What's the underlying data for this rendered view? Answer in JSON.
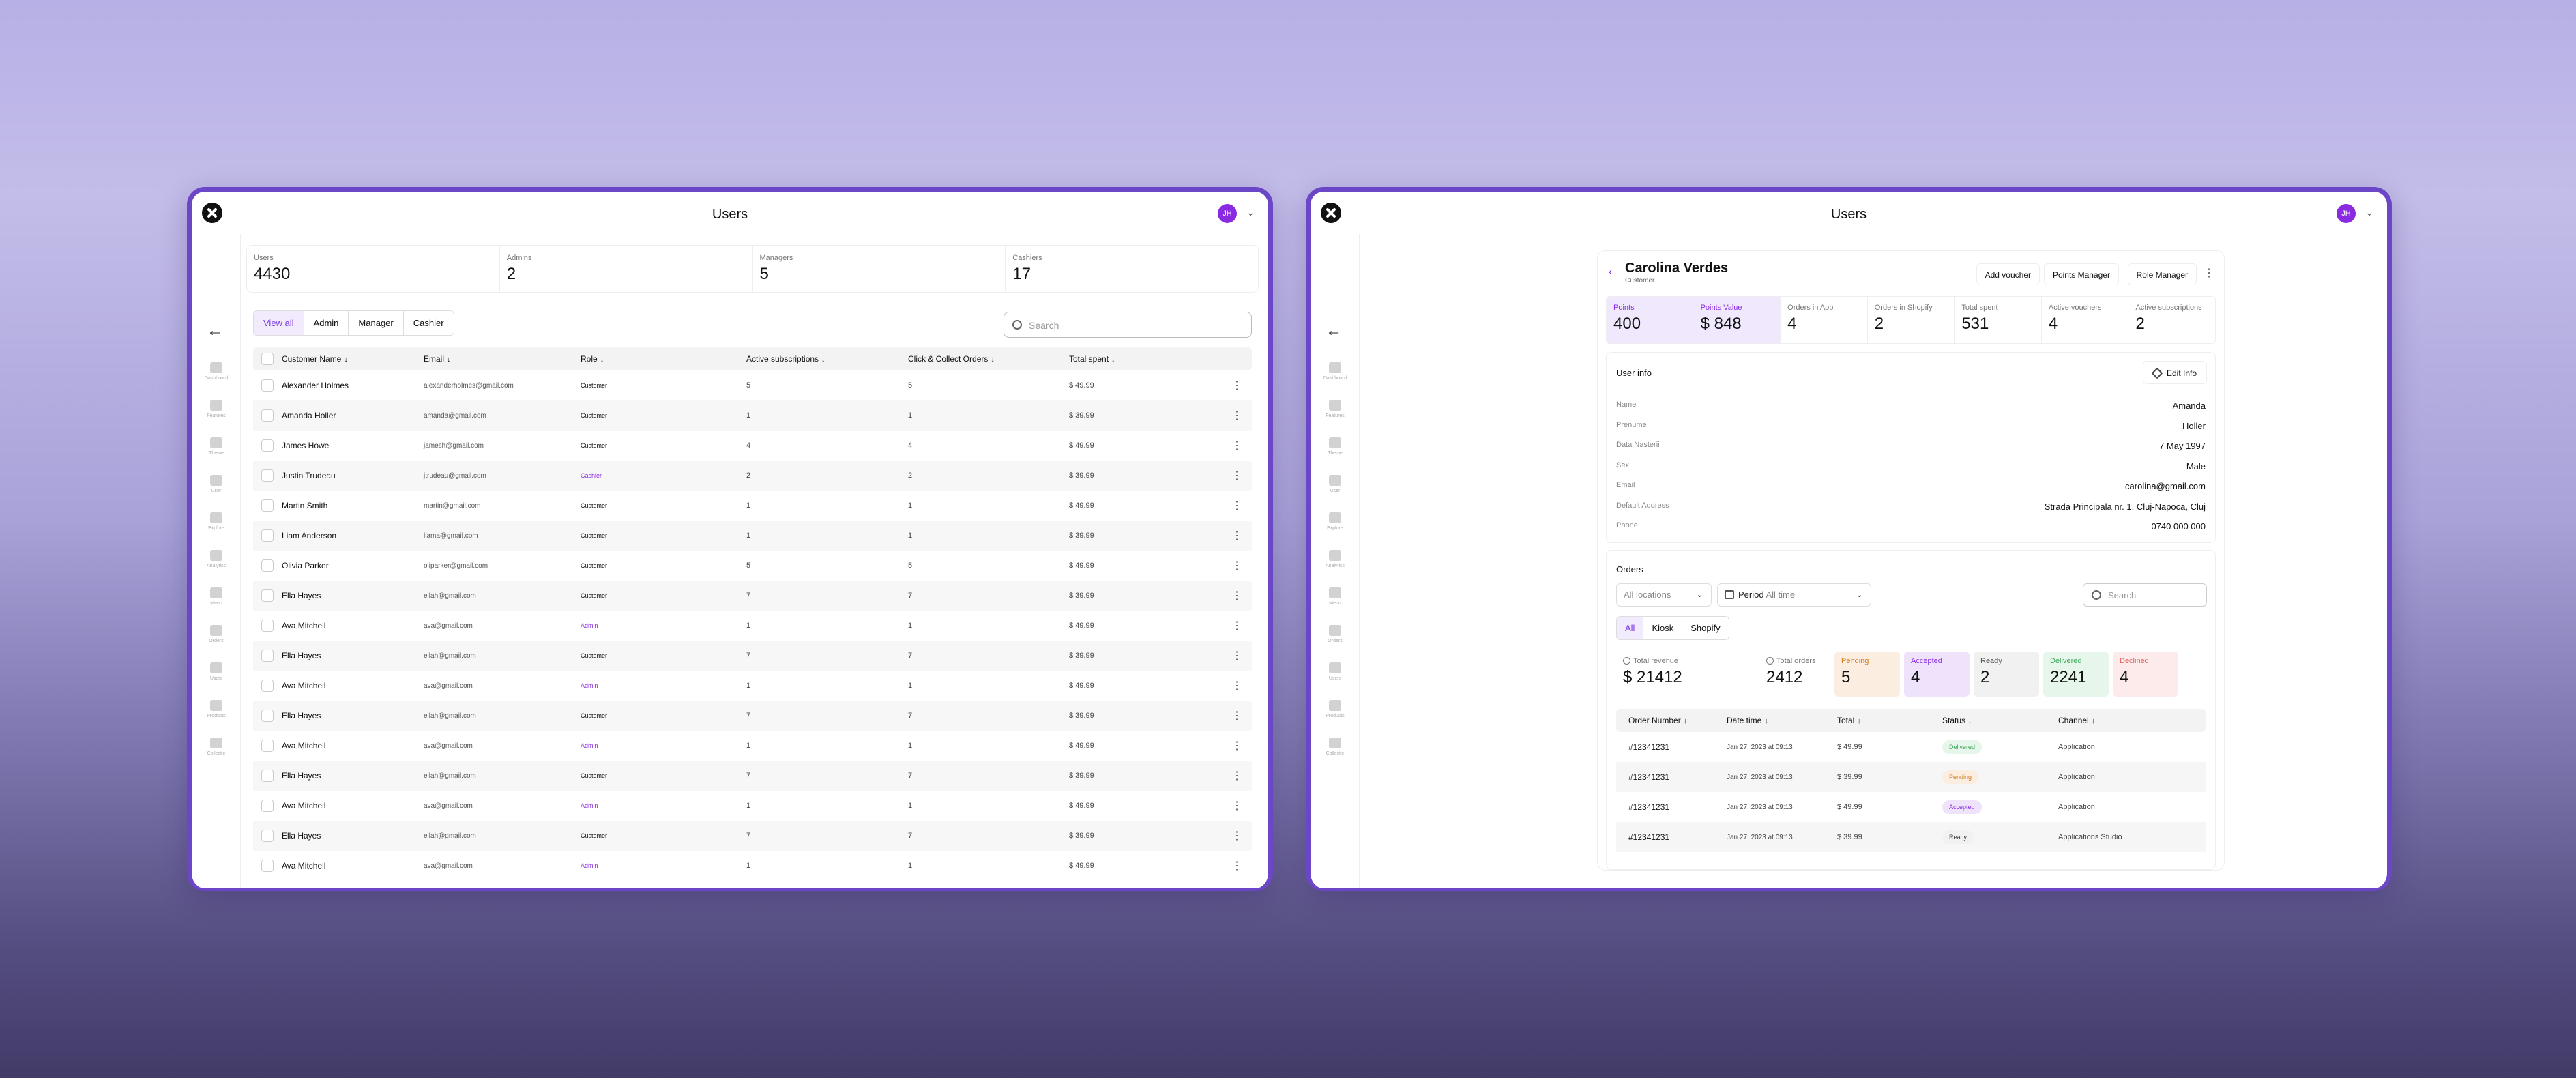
{
  "users_window": {
    "title": "Users",
    "avatar_initials": "JH",
    "sidebar": [
      "Dashboard",
      "Features",
      "Theme",
      "User",
      "Explore",
      "Analytics",
      "Menu",
      "Orders",
      "Users",
      "Products",
      "Collectie"
    ],
    "stats": [
      {
        "label": "Users",
        "value": "4430"
      },
      {
        "label": "Admins",
        "value": "2"
      },
      {
        "label": "Managers",
        "value": "5"
      },
      {
        "label": "Cashiers",
        "value": "17"
      }
    ],
    "tabs": [
      "View all",
      "Admin",
      "Manager",
      "Cashier"
    ],
    "search_placeholder": "Search",
    "columns": [
      "Customer Name",
      "Email",
      "Role",
      "Active subscriptions",
      "Click & Collect Orders",
      "Total spent"
    ],
    "rows": [
      {
        "name": "Alexander Holmes",
        "email": "alexanderholmes@gmail.com",
        "role": "Customer",
        "subs": "5",
        "orders": "5",
        "total": "$ 49.99"
      },
      {
        "name": "Amanda Holler",
        "email": "amanda@gmail.com",
        "role": "Customer",
        "subs": "1",
        "orders": "1",
        "total": "$ 39.99"
      },
      {
        "name": "James Howe",
        "email": "jamesh@gmail.com",
        "role": "Customer",
        "subs": "4",
        "orders": "4",
        "total": "$ 49.99"
      },
      {
        "name": "Justin Trudeau",
        "email": "jtrudeau@gmail.com",
        "role": "Cashier",
        "subs": "2",
        "orders": "2",
        "total": "$ 39.99"
      },
      {
        "name": "Martin Smith",
        "email": "martin@gmail.com",
        "role": "Customer",
        "subs": "1",
        "orders": "1",
        "total": "$ 49.99"
      },
      {
        "name": "Liam Anderson",
        "email": "liama@gmail.com",
        "role": "Customer",
        "subs": "1",
        "orders": "1",
        "total": "$ 39.99"
      },
      {
        "name": "Olivia Parker",
        "email": "oliparker@gmail.com",
        "role": "Customer",
        "subs": "5",
        "orders": "5",
        "total": "$ 49.99"
      },
      {
        "name": "Ella Hayes",
        "email": "ellah@gmail.com",
        "role": "Customer",
        "subs": "7",
        "orders": "7",
        "total": "$ 39.99"
      },
      {
        "name": "Ava Mitchell",
        "email": "ava@gmail.com",
        "role": "Admin",
        "subs": "1",
        "orders": "1",
        "total": "$ 49.99"
      },
      {
        "name": "Ella Hayes",
        "email": "ellah@gmail.com",
        "role": "Customer",
        "subs": "7",
        "orders": "7",
        "total": "$ 39.99"
      },
      {
        "name": "Ava Mitchell",
        "email": "ava@gmail.com",
        "role": "Admin",
        "subs": "1",
        "orders": "1",
        "total": "$ 49.99"
      },
      {
        "name": "Ella Hayes",
        "email": "ellah@gmail.com",
        "role": "Customer",
        "subs": "7",
        "orders": "7",
        "total": "$ 39.99"
      },
      {
        "name": "Ava Mitchell",
        "email": "ava@gmail.com",
        "role": "Admin",
        "subs": "1",
        "orders": "1",
        "total": "$ 49.99"
      },
      {
        "name": "Ella Hayes",
        "email": "ellah@gmail.com",
        "role": "Customer",
        "subs": "7",
        "orders": "7",
        "total": "$ 39.99"
      },
      {
        "name": "Ava Mitchell",
        "email": "ava@gmail.com",
        "role": "Admin",
        "subs": "1",
        "orders": "1",
        "total": "$ 49.99"
      },
      {
        "name": "Ella Hayes",
        "email": "ellah@gmail.com",
        "role": "Customer",
        "subs": "7",
        "orders": "7",
        "total": "$ 39.99"
      },
      {
        "name": "Ava Mitchell",
        "email": "ava@gmail.com",
        "role": "Admin",
        "subs": "1",
        "orders": "1",
        "total": "$ 49.99"
      }
    ]
  },
  "customer_window": {
    "title": "Users",
    "avatar_initials": "JH",
    "sidebar": [
      "Dashboard",
      "Features",
      "Theme",
      "User",
      "Explore",
      "Analytics",
      "Menu",
      "Orders",
      "Users",
      "Products",
      "Collectie"
    ],
    "customer_name": "Carolina Verdes",
    "customer_role": "Customer",
    "actions": [
      "Add voucher",
      "Points Manager",
      "Role Manager"
    ],
    "metrics": [
      {
        "label": "Points",
        "value": "400"
      },
      {
        "label": "Points Value",
        "value": "$ 848"
      },
      {
        "label": "Orders in App",
        "value": "4"
      },
      {
        "label": "Orders in Shopify",
        "value": "2"
      },
      {
        "label": "Total spent",
        "value": "531"
      },
      {
        "label": "Active vouchers",
        "value": "4"
      },
      {
        "label": "Active subscriptions",
        "value": "2"
      }
    ],
    "user_info_title": "User info",
    "edit_label": "Edit Info",
    "info": [
      {
        "key": "Name",
        "value": "Amanda"
      },
      {
        "key": "Prenume",
        "value": "Holler"
      },
      {
        "key": "Data Nasterii",
        "value": "7 May 1997"
      },
      {
        "key": "Sex",
        "value": "Male"
      },
      {
        "key": "Email",
        "value": "carolina@gmail.com"
      },
      {
        "key": "Default Address",
        "value": "Strada Principala nr. 1, Cluj-Napoca, Cluj"
      },
      {
        "key": "Phone",
        "value": "0740 000 000"
      }
    ],
    "orders_title": "Orders",
    "location_filter": "All locations",
    "period_label": "Period",
    "period_value": "All time",
    "search_placeholder": "Search",
    "order_tabs": [
      "All",
      "Kiosk",
      "Shopify"
    ],
    "order_stats": [
      {
        "label": "Total revenue",
        "value": "$ 21412",
        "bg": "#ffffff",
        "color": "#777777"
      },
      {
        "label": "Total orders",
        "value": "2412",
        "bg": "#ffffff",
        "color": "#777777"
      },
      {
        "label": "Pending",
        "value": "5",
        "bg": "#fbeee0",
        "color": "#d07a1e"
      },
      {
        "label": "Accepted",
        "value": "4",
        "bg": "#efe3fb",
        "color": "#8a2be2"
      },
      {
        "label": "Ready",
        "value": "2",
        "bg": "#f1f1f1",
        "color": "#555555"
      },
      {
        "label": "Delivered",
        "value": "2241",
        "bg": "#e6f6ea",
        "color": "#3aa85a"
      },
      {
        "label": "Declined",
        "value": "4",
        "bg": "#fdeaea",
        "color": "#e06060"
      }
    ],
    "order_columns": [
      "Order Number",
      "Date time",
      "Total",
      "Status",
      "Channel"
    ],
    "order_rows": [
      {
        "number": "#12341231",
        "date": "Jan 27, 2023 at 09:13",
        "total": "$ 49.99",
        "status": "Delivered",
        "status_bg": "#e6f6ea",
        "status_color": "#3aa85a",
        "channel": "Application"
      },
      {
        "number": "#12341231",
        "date": "Jan 27, 2023 at 09:13",
        "total": "$  39.99",
        "status": "Pending",
        "status_bg": "#fbeee0",
        "status_color": "#d07a1e",
        "channel": "Application"
      },
      {
        "number": "#12341231",
        "date": "Jan 27, 2023 at 09:13",
        "total": "$  49.99",
        "status": "Accepted",
        "status_bg": "#efe3fb",
        "status_color": "#8a2be2",
        "channel": "Application"
      },
      {
        "number": "#12341231",
        "date": "Jan 27, 2023 at 09:13",
        "total": "$  39.99",
        "status": "Ready",
        "status_bg": "#f1f1f1",
        "status_color": "#333333",
        "channel": "Applications Studio"
      }
    ]
  }
}
